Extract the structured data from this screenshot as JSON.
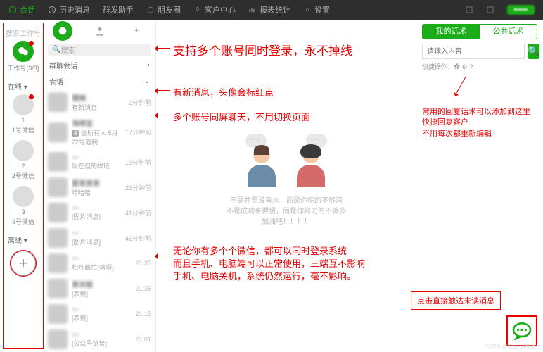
{
  "topbar": {
    "items": [
      {
        "label": "会话",
        "active": true
      },
      {
        "label": "历史消息"
      },
      {
        "label": "群发助手"
      },
      {
        "label": "朋友圈"
      },
      {
        "label": "客户中心"
      },
      {
        "label": "报表统计"
      },
      {
        "label": "设置"
      }
    ]
  },
  "rail": {
    "search_placeholder": "搜索工作号",
    "work_label": "工作号(3/3)",
    "online_label": "在线",
    "offline_label": "离线",
    "accounts": [
      {
        "num": "1",
        "sub": "1号微信"
      },
      {
        "num": "2",
        "sub": "2号微信"
      },
      {
        "num": "3",
        "sub": "3号微信"
      }
    ]
  },
  "conv": {
    "search_placeholder": "搜索",
    "group_label": "群聊会话",
    "chat_label": "会话",
    "items": [
      {
        "name": "摆摊",
        "sub": "有新消息",
        "time": "2分钟前"
      },
      {
        "name": "海绵宝",
        "sub": "@所有人 5月22号返利",
        "time": "17分钟前",
        "badge": "9"
      },
      {
        "name": "—",
        "sub": "现在但的样班",
        "time": "19分钟前"
      },
      {
        "name": "霍莱莱莱",
        "sub": "哈哈哈",
        "time": "22分钟前"
      },
      {
        "name": "—",
        "sub": "[图片消息]",
        "time": "41分钟前"
      },
      {
        "name": "—",
        "sub": "[图片消息]",
        "time": "46分钟前"
      },
      {
        "name": "—",
        "sub": "相互都忙(啥呀)",
        "time": "21:35"
      },
      {
        "name": "黑羊糕",
        "sub": "[表情]",
        "time": "21:35"
      },
      {
        "name": "—",
        "sub": "[表情]",
        "time": "21:15"
      },
      {
        "name": "—",
        "sub": "[公众号链接]",
        "time": "21:01"
      }
    ]
  },
  "callouts": {
    "c1": "支持多个账号同时登录，永不掉线",
    "c2": "有新消息，头像会标红点",
    "c3": "多个账号同屏聊天，不用切换页面",
    "c4": "无论你有多个个微信，都可以同时登录系统\n而且手机、电脑端可以正常使用，三端互不影响\n手机、电脑关机，系统仍然运行，毫不影响。",
    "r1": "常用的回复话术可以添加到这里\n快捷回复客户\n不用每次都重新编辑",
    "box": "点击直接触达未读消息"
  },
  "illus_text": "不是井里没有水，而是你挖的不够深\n不是成功来得慢，而是你努力的不够多\n加油吧！！！！",
  "right": {
    "tab_on": "我的话术",
    "tab_off": "公共话术",
    "input_ph": "请输入内容",
    "ops": "快捷操作："
  },
  "watermark": "CSDN @企业小帮手"
}
